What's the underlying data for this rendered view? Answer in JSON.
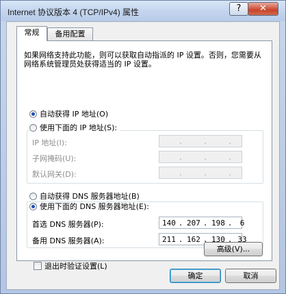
{
  "window": {
    "title": "Internet 协议版本 4 (TCP/IPv4) 属性",
    "help_label": "?",
    "close_label": "✕"
  },
  "tabs": [
    {
      "label": "常规",
      "active": true
    },
    {
      "label": "备用配置",
      "active": false
    }
  ],
  "description": "如果网络支持此功能，则可以获取自动指派的 IP 设置。否则，您需要从网络系统管理员处获得适当的 IP 设置。",
  "ip_options": {
    "auto": {
      "label": "自动获得 IP 地址(O)",
      "selected": true
    },
    "manual": {
      "label": "使用下面的 IP 地址(S):",
      "selected": false
    }
  },
  "ip_fields": [
    {
      "label": "IP 地址(I):",
      "octets": [
        "",
        "",
        "",
        ""
      ]
    },
    {
      "label": "子网掩码(U):",
      "octets": [
        "",
        "",
        "",
        ""
      ]
    },
    {
      "label": "默认网关(D):",
      "octets": [
        "",
        "",
        "",
        ""
      ]
    }
  ],
  "dns_options": {
    "auto": {
      "label": "自动获得 DNS 服务器地址(B)",
      "selected": false
    },
    "manual": {
      "label": "使用下面的 DNS 服务器地址(E):",
      "selected": true
    }
  },
  "dns_fields": [
    {
      "label": "首选 DNS 服务器(P):",
      "octets": [
        "140",
        "207",
        "198",
        "6"
      ]
    },
    {
      "label": "备用 DNS 服务器(A):",
      "octets": [
        "211",
        "162",
        "130",
        "33"
      ]
    }
  ],
  "validate_on_exit": {
    "label": "退出时验证设置(L)",
    "checked": false
  },
  "buttons": {
    "advanced": "高级(V)...",
    "ok": "确定",
    "cancel": "取消"
  },
  "colors": {
    "title_bar": "#c3d5ee",
    "close_button": "#c9442b",
    "radio_dot": "#1d4fb0"
  }
}
